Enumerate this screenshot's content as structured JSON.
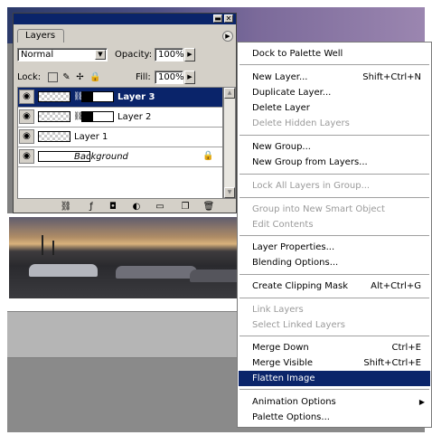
{
  "palette": {
    "tab_label": "Layers",
    "blend_mode": "Normal",
    "opacity_label": "Opacity:",
    "opacity_value": "100%",
    "lock_label": "Lock:",
    "fill_label": "Fill:",
    "fill_value": "100%",
    "layers": [
      {
        "name": "Layer 3",
        "selected": true,
        "has_mask": true
      },
      {
        "name": "Layer 2",
        "selected": false,
        "has_mask": true
      },
      {
        "name": "Layer 1",
        "selected": false,
        "has_mask": false
      },
      {
        "name": "Background",
        "selected": false,
        "has_mask": false,
        "locked": true
      }
    ],
    "icons": {
      "eye": "eye-icon",
      "menu": "palette-menu-icon",
      "link": "link-layers-icon",
      "style": "layer-style-icon",
      "mask": "layer-mask-icon",
      "adjust": "adjustment-layer-icon",
      "group": "new-group-icon",
      "new": "new-layer-icon",
      "trash": "delete-layer-icon"
    }
  },
  "menu": {
    "items": [
      {
        "label": "Dock to Palette Well",
        "shortcut": "",
        "disabled": false
      },
      {
        "label": "New Layer...",
        "shortcut": "Shift+Ctrl+N",
        "disabled": false
      },
      {
        "label": "Duplicate Layer...",
        "shortcut": "",
        "disabled": false
      },
      {
        "label": "Delete Layer",
        "shortcut": "",
        "disabled": false
      },
      {
        "label": "Delete Hidden Layers",
        "shortcut": "",
        "disabled": true
      },
      {
        "label": "New Group...",
        "shortcut": "",
        "disabled": false
      },
      {
        "label": "New Group from Layers...",
        "shortcut": "",
        "disabled": false
      },
      {
        "label": "Lock All Layers in Group...",
        "shortcut": "",
        "disabled": true
      },
      {
        "label": "Group into New Smart Object",
        "shortcut": "",
        "disabled": true
      },
      {
        "label": "Edit Contents",
        "shortcut": "",
        "disabled": true
      },
      {
        "label": "Layer Properties...",
        "shortcut": "",
        "disabled": false
      },
      {
        "label": "Blending Options...",
        "shortcut": "",
        "disabled": false
      },
      {
        "label": "Create Clipping Mask",
        "shortcut": "Alt+Ctrl+G",
        "disabled": false
      },
      {
        "label": "Link Layers",
        "shortcut": "",
        "disabled": true
      },
      {
        "label": "Select Linked Layers",
        "shortcut": "",
        "disabled": true
      },
      {
        "label": "Merge Down",
        "shortcut": "Ctrl+E",
        "disabled": false
      },
      {
        "label": "Merge Visible",
        "shortcut": "Shift+Ctrl+E",
        "disabled": false
      },
      {
        "label": "Flatten Image",
        "shortcut": "",
        "disabled": false,
        "highlighted": true
      },
      {
        "label": "Animation Options",
        "shortcut": "",
        "disabled": false,
        "submenu": true
      },
      {
        "label": "Palette Options...",
        "shortcut": "",
        "disabled": false
      }
    ]
  },
  "colors": {
    "selection": "#0a246a",
    "panel": "#d4d0c8",
    "disabled_text": "#9a9a9a"
  }
}
